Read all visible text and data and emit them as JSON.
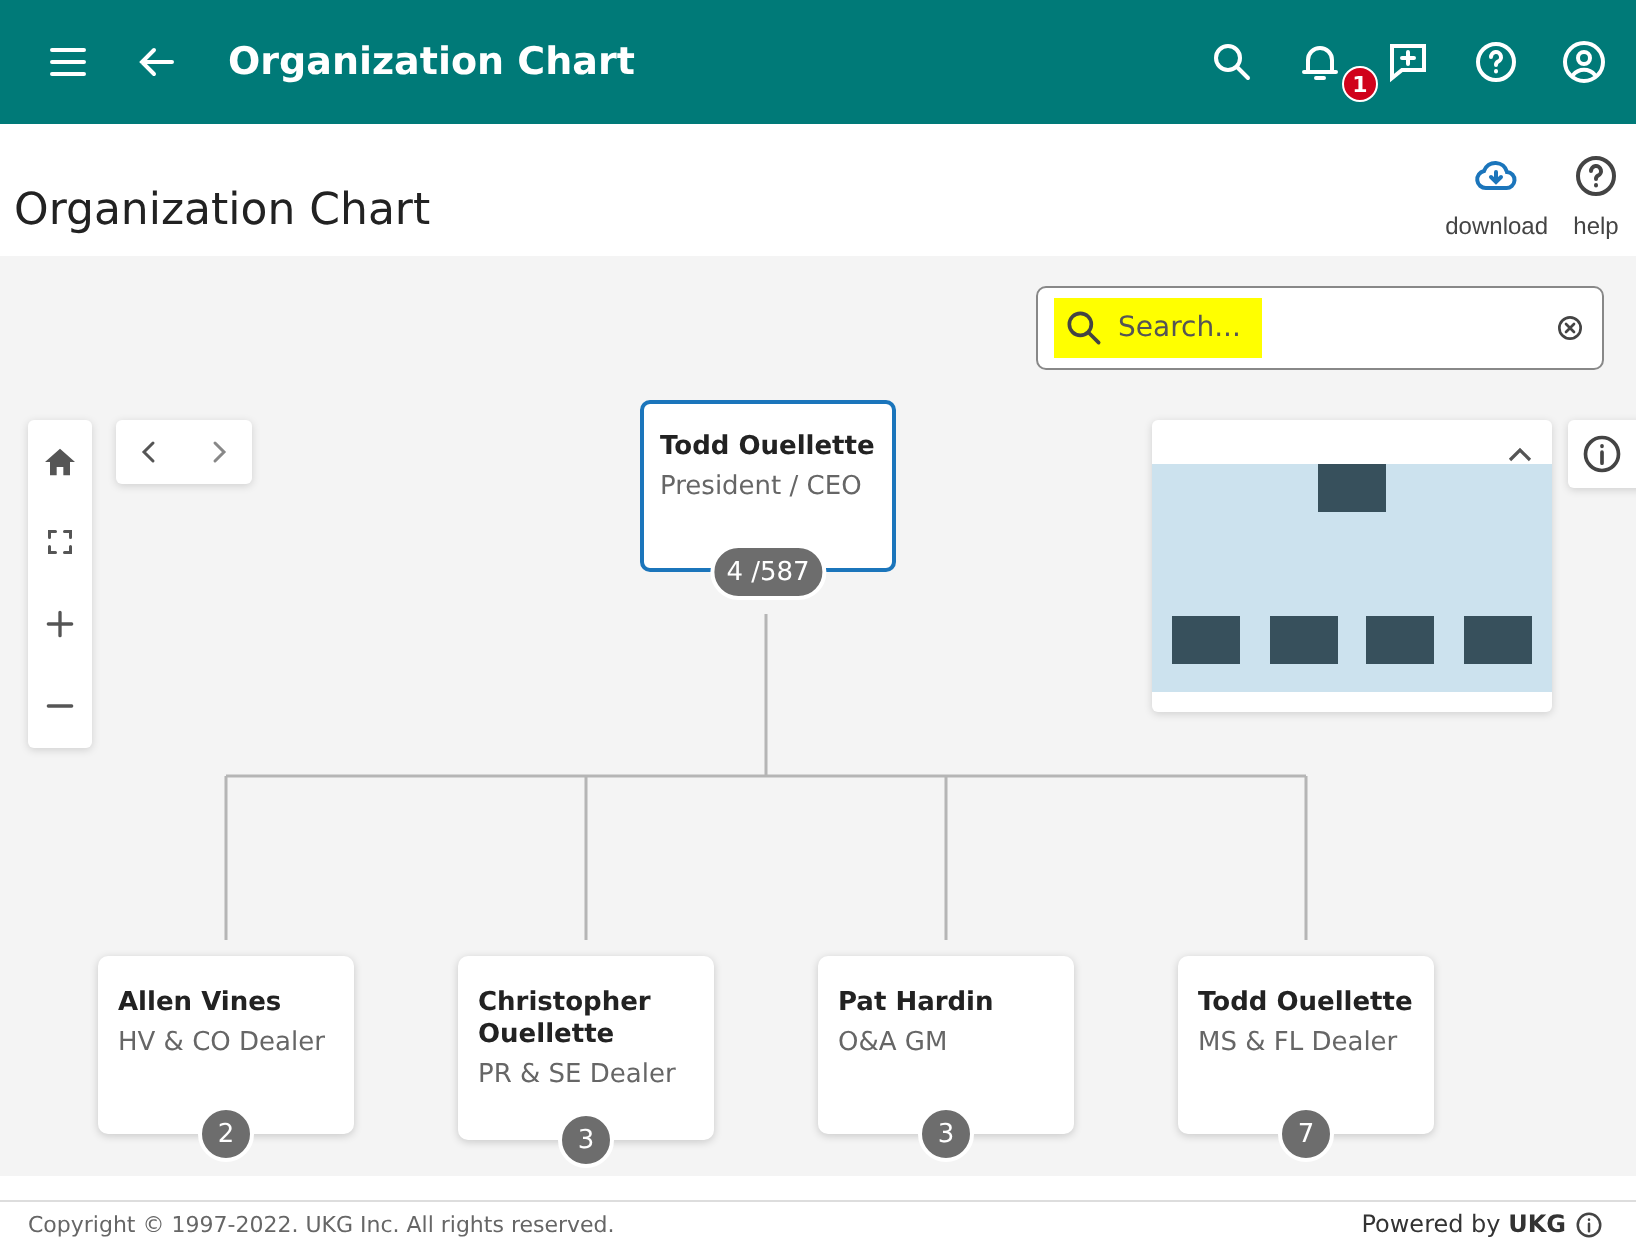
{
  "app_bar": {
    "title": "Organization Chart",
    "notification_count": "1"
  },
  "page": {
    "title": "Organization Chart",
    "actions": [
      {
        "kind": "download",
        "label": "download"
      },
      {
        "kind": "help",
        "label": "help"
      }
    ]
  },
  "search": {
    "placeholder": "Search..."
  },
  "org_chart": {
    "name": "Todd Ouellette",
    "role": "President / CEO",
    "count": "4 /587",
    "selected": true,
    "children": [
      {
        "name": "Allen Vines",
        "role": "HV & CO Dealer",
        "count": "2",
        "selected": false
      },
      {
        "name": "Christopher Ouellette",
        "role": "PR & SE Dealer",
        "count": "3",
        "selected": false
      },
      {
        "name": "Pat Hardin",
        "role": "O&A GM",
        "count": "3",
        "selected": false
      },
      {
        "name": "Todd Ouellette",
        "role": "MS & FL Dealer",
        "count": "7",
        "selected": false
      }
    ]
  },
  "footer": {
    "copyright": "Copyright © 1997-2022. UKG Inc. All rights reserved.",
    "powered_by": "Powered by **UKG**"
  }
}
